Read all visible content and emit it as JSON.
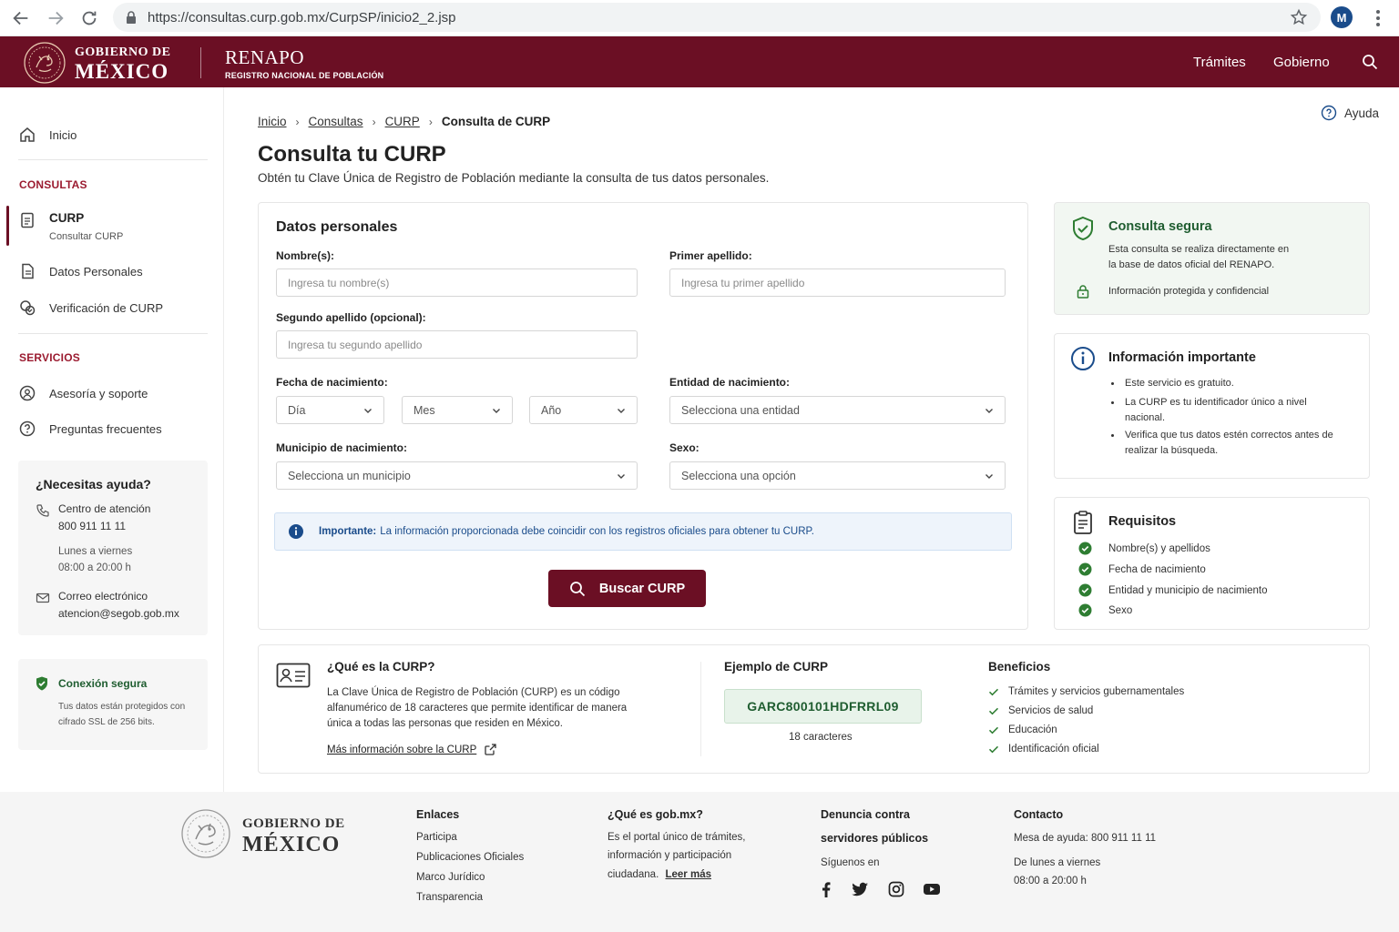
{
  "browser": {
    "url": "https://consultas.curp.gob.mx/CurpSP/inicio2_2.jsp",
    "profile_initial": "M"
  },
  "header": {
    "gob_line1": "GOBIERNO DE",
    "gob_line2": "MÉXICO",
    "renapo": "RENAPO",
    "renapo_sub": "REGISTRO NACIONAL DE POBLACIÓN",
    "nav": [
      "Trámites",
      "Gobierno"
    ],
    "brand_color": "#6b0f24"
  },
  "sidebar": {
    "home": "Inicio",
    "section_consultas": "CONSULTAS",
    "curp_title": "CURP",
    "curp_sub": "Consultar CURP",
    "datos": "Datos Personales",
    "verificacion": "Verificación de CURP",
    "section_servicios": "SERVICIOS",
    "asesoria": "Asesoría y soporte",
    "preguntas": "Preguntas frecuentes",
    "help": {
      "title": "¿Necesitas ayuda?",
      "phone_label": "Centro de atención",
      "phone": "800 911 11 11",
      "days": "Lunes a viernes",
      "hours": "08:00 a 20:00 h",
      "email_label": "Correo electrónico",
      "email": "atencion@segob.gob.mx"
    },
    "secure": {
      "title": "Conexión segura",
      "line1": "Tus datos están protegidos con",
      "line2": "cifrado SSL de 256 bits."
    }
  },
  "main": {
    "breadcrumb": [
      "Inicio",
      "Consultas",
      "CURP",
      "Consulta de CURP"
    ],
    "help": "Ayuda",
    "title": "Consulta tu CURP",
    "subtitle": "Obtén tu Clave Única de Registro de Población mediante la consulta de tus datos personales."
  },
  "form": {
    "title": "Datos personales",
    "nombre_label": "Nombre(s):",
    "nombre_ph": "Ingresa tu nombre(s)",
    "apellido1_label": "Primer apellido:",
    "apellido1_ph": "Ingresa tu primer apellido",
    "apellido2_label": "Segundo apellido (opcional):",
    "apellido2_ph": "Ingresa tu segundo apellido",
    "fecha_label": "Fecha de nacimiento:",
    "dia": "Día",
    "mes": "Mes",
    "anio": "Año",
    "entidad_label": "Entidad de nacimiento:",
    "entidad": "Selecciona una entidad",
    "municipio_label": "Municipio de nacimiento:",
    "municipio": "Selecciona un municipio",
    "sexo_label": "Sexo:",
    "sexo": "Selecciona una opción",
    "info_bold": "Importante:",
    "info_text": "La información proporcionada debe coincidir con los registros oficiales para obtener tu CURP.",
    "button": "Buscar CURP"
  },
  "right": {
    "secure_title": "Consulta segura",
    "secure_l1": "Esta consulta se realiza directamente en",
    "secure_l2": "la base de datos oficial del RENAPO.",
    "secure_lock": "Información protegida y confidencial",
    "info_title": "Información importante",
    "info_b1": "Este servicio es gratuito.",
    "info_b2": "La CURP es tu identificador único a nivel nacional.",
    "info_b3": "Verifica que tus datos estén correctos antes de realizar la búsqueda.",
    "req_title": "Requisitos",
    "reqs": [
      "Nombre(s) y apellidos",
      "Fecha de nacimiento",
      "Entidad y municipio de nacimiento",
      "Sexo"
    ]
  },
  "bottom": {
    "what_title": "¿Qué es la CURP?",
    "what_l1": "La Clave Única de Registro de Población (CURP) es un código",
    "what_l2": "alfanumérico de 18 caracteres que permite identificar de manera",
    "what_l3": "única a todas las personas que residen en México.",
    "more": "Más información sobre la CURP",
    "example_title": "Ejemplo de CURP",
    "example": "GARC800101HDFRRL09",
    "example_len": "18 caracteres",
    "benef_title": "Beneficios",
    "benefits": [
      "Trámites y servicios gubernamentales",
      "Servicios de salud",
      "Educación",
      "Identificación oficial"
    ]
  },
  "footer": {
    "gob_line1": "GOBIERNO DE",
    "gob_line2": "MÉXICO",
    "enlaces_title": "Enlaces",
    "enlaces": [
      "Participa",
      "Publicaciones Oficiales",
      "Marco Jurídico",
      "Transparencia"
    ],
    "que_title": "¿Qué es gob.mx?",
    "que_l1": "Es el portal único de trámites,",
    "que_l2": "información y participación",
    "que_l3": "ciudadana.",
    "leer": "Leer más",
    "denuncia_l1": "Denuncia contra",
    "denuncia_l2": "servidores públicos",
    "siguenos": "Síguenos en",
    "contacto_title": "Contacto",
    "mesa": "Mesa de ayuda: 800 911 11 11",
    "dias": "De lunes a viernes",
    "horas": "08:00 a 20:00 h"
  }
}
